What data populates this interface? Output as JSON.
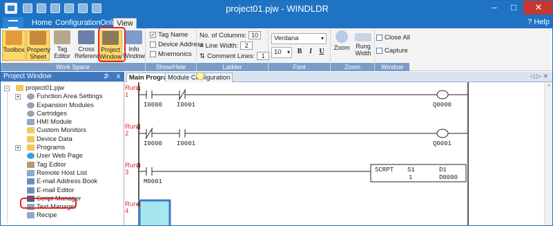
{
  "window": {
    "title": "project01.pjw - WINDLDR",
    "min": "–",
    "max": "□",
    "close": "✕"
  },
  "menu": {
    "tabs": [
      "Home",
      "Configuration",
      "Online",
      "View"
    ],
    "active": "View",
    "help": "Help"
  },
  "ribbon": {
    "workspace": {
      "label": "Work Space",
      "buttons": [
        "Toolbox",
        "Property Sheet",
        "Tag Editor",
        "Cross Reference",
        "Project Window",
        "Info Window"
      ],
      "highlighted": "Project Window"
    },
    "showhide": {
      "label": "Show/Hide",
      "items": [
        {
          "text": "Tag Name",
          "checked": true
        },
        {
          "text": "Device Address",
          "checked": false
        },
        {
          "text": "Mnemonics",
          "checked": false
        }
      ]
    },
    "ladder": {
      "label": "Ladder",
      "columns_label": "No. of Columns:",
      "columns": "10",
      "linewidth_label": "Line Width:",
      "linewidth": "2",
      "comment_label": "Comment Lines:",
      "comment": "1"
    },
    "font": {
      "label": "Font",
      "name": "Verdana",
      "size": "10",
      "bold": "B",
      "italic": "I",
      "underline": "U"
    },
    "zoom": {
      "label": "Zoom",
      "zoom": "Zoom",
      "rung_width": "Rung Width"
    },
    "windowgrp": {
      "label": "Window",
      "close_all": "Close All",
      "capture": "Capture"
    }
  },
  "project_window": {
    "title": "Project Window",
    "pin": "⊅",
    "close": "x",
    "items": [
      {
        "label": "project01.pjw",
        "icon": "folder-icon",
        "indent": 0
      },
      {
        "label": "Function Area Settings",
        "icon": "gear-icon",
        "indent": 1
      },
      {
        "label": "Expansion Modules",
        "icon": "gear-icon",
        "indent": 1
      },
      {
        "label": "Cartridges",
        "icon": "gear-icon",
        "indent": 1
      },
      {
        "label": "HMI Module",
        "icon": "doc-icon",
        "indent": 1
      },
      {
        "label": "Custom Monitors",
        "icon": "folder-icon",
        "indent": 1
      },
      {
        "label": "Device Data",
        "icon": "folder-icon",
        "indent": 1
      },
      {
        "label": "Programs",
        "icon": "folder-icon",
        "indent": 1
      },
      {
        "label": "User Web Page",
        "icon": "web-icon",
        "indent": 1
      },
      {
        "label": "Tag Editor",
        "icon": "tag-icon",
        "indent": 1
      },
      {
        "label": "Remote Host List",
        "icon": "doc-icon",
        "indent": 1
      },
      {
        "label": "E-mail Address Book",
        "icon": "mail-icon",
        "indent": 1
      },
      {
        "label": "E-mail Editor",
        "icon": "mail-icon",
        "indent": 1
      },
      {
        "label": "Script Manager",
        "icon": "script-icon",
        "indent": 1
      },
      {
        "label": "Text Manager",
        "icon": "doc-icon",
        "indent": 1
      },
      {
        "label": "Recipe",
        "icon": "doc-icon",
        "indent": 1
      }
    ]
  },
  "editor": {
    "tabs": [
      "Main Program",
      "Module Configuration"
    ],
    "active_tab": "Main Program",
    "scroll_arrows": "◁ ▷ ✕",
    "rungs": [
      {
        "label": "Rung",
        "num": "1",
        "ops": [
          "I0000",
          "I0001"
        ],
        "coil": "Q0000"
      },
      {
        "label": "Rung",
        "num": "2",
        "ops": [
          "I0000",
          "I0001"
        ],
        "coil": "Q0001"
      },
      {
        "label": "Rung",
        "num": "3",
        "ops": [
          "M0001"
        ],
        "instr": "SCRPT",
        "s1": "S1",
        "s1val": "1",
        "d1": "D1",
        "d1val": "D0000"
      },
      {
        "label": "Rung",
        "num": "4"
      }
    ]
  }
}
